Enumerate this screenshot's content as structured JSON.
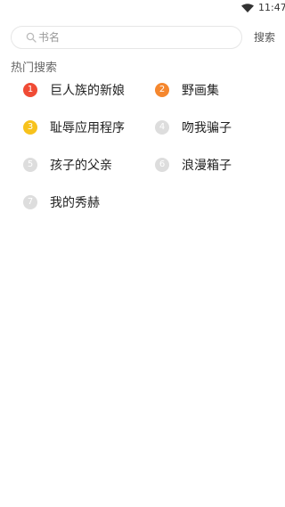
{
  "status_bar": {
    "time": "11:47",
    "wifi_icon": "wifi-icon"
  },
  "search": {
    "placeholder": "书名",
    "button_label": "搜索",
    "icon": "search-icon"
  },
  "hot_search": {
    "title": "热门搜索",
    "items": [
      {
        "rank": "1",
        "label": "巨人族的新娘",
        "badge_color": "#F04B35"
      },
      {
        "rank": "2",
        "label": "野画集",
        "badge_color": "#F5872E"
      },
      {
        "rank": "3",
        "label": "耻辱应用程序",
        "badge_color": "#F7C21C"
      },
      {
        "rank": "4",
        "label": "吻我骗子",
        "badge_color": "#DDDDDD"
      },
      {
        "rank": "5",
        "label": "孩子的父亲",
        "badge_color": "#DDDDDD"
      },
      {
        "rank": "6",
        "label": "浪漫箱子",
        "badge_color": "#DDDDDD"
      },
      {
        "rank": "7",
        "label": "我的秀赫",
        "badge_color": "#DDDDDD"
      }
    ]
  }
}
